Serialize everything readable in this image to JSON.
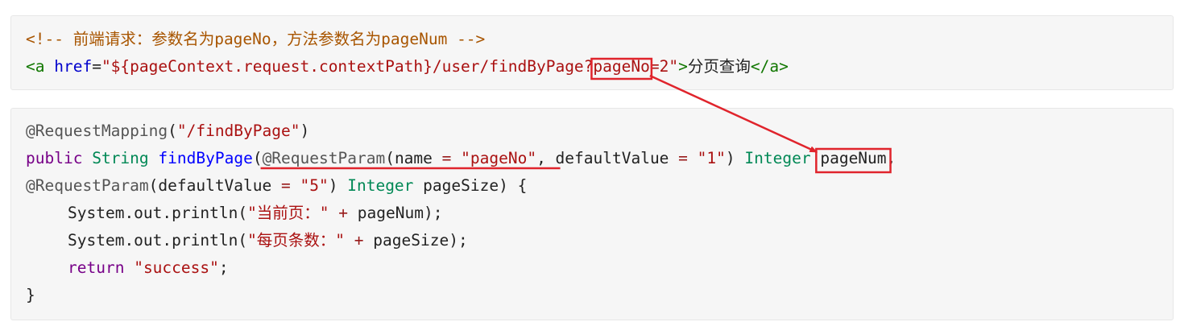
{
  "block1": {
    "line1": {
      "comment_open": "<!-- ",
      "comment_text": "前端请求：参数名为pageNo，方法参数名为pageNum",
      "comment_close": " -->"
    },
    "line2": {
      "tag_open": "<a",
      "attr_name": " href",
      "equals": "=",
      "href_value_prefix": "\"${pageContext.request.contextPath}/user/findByPage?",
      "href_param_name": "pageNo",
      "href_value_suffix": "=2\"",
      "gt": ">",
      "link_text": "分页查询",
      "tag_close": "</a>"
    }
  },
  "block2": {
    "line1": {
      "annotation": "@RequestMapping",
      "paren_open": "(",
      "path": "\"/findByPage\"",
      "paren_close": ")"
    },
    "line2": {
      "kw_public": "public",
      "type_string": "String",
      "method": "findByPage",
      "paren_open": "(",
      "annotation": "@RequestParam",
      "p_open": "(",
      "name_key": "name",
      "eq1": " = ",
      "name_value": "\"pageNo\"",
      "comma1": ", ",
      "default_key": "defaultValue",
      "eq2": " = ",
      "default_value": "\"1\"",
      "p_close": ")",
      "type_integer": "Integer",
      "param_name": "pageNum",
      "comma2": ","
    },
    "line3": {
      "annotation": "@RequestParam",
      "p_open": "(",
      "default_key": "defaultValue",
      "eq": " = ",
      "default_value": "\"5\"",
      "p_close": ")",
      "type_integer": "Integer",
      "param_name": "pageSize",
      "tail": ") {"
    },
    "line4": {
      "prefix": "System.out.println(",
      "str": "\"当前页：\"",
      "plus": " + ",
      "var": "pageNum",
      "tail": ");"
    },
    "line5": {
      "prefix": "System.out.println(",
      "str": "\"每页条数：\"",
      "plus": " + ",
      "var": "pageSize",
      "tail": ");"
    },
    "line6": {
      "kw_return": "return",
      "str": "\"success\"",
      "semi": ";"
    },
    "line7": {
      "brace": "}"
    }
  },
  "annotations": {
    "highlight_color": "#e0242c"
  }
}
